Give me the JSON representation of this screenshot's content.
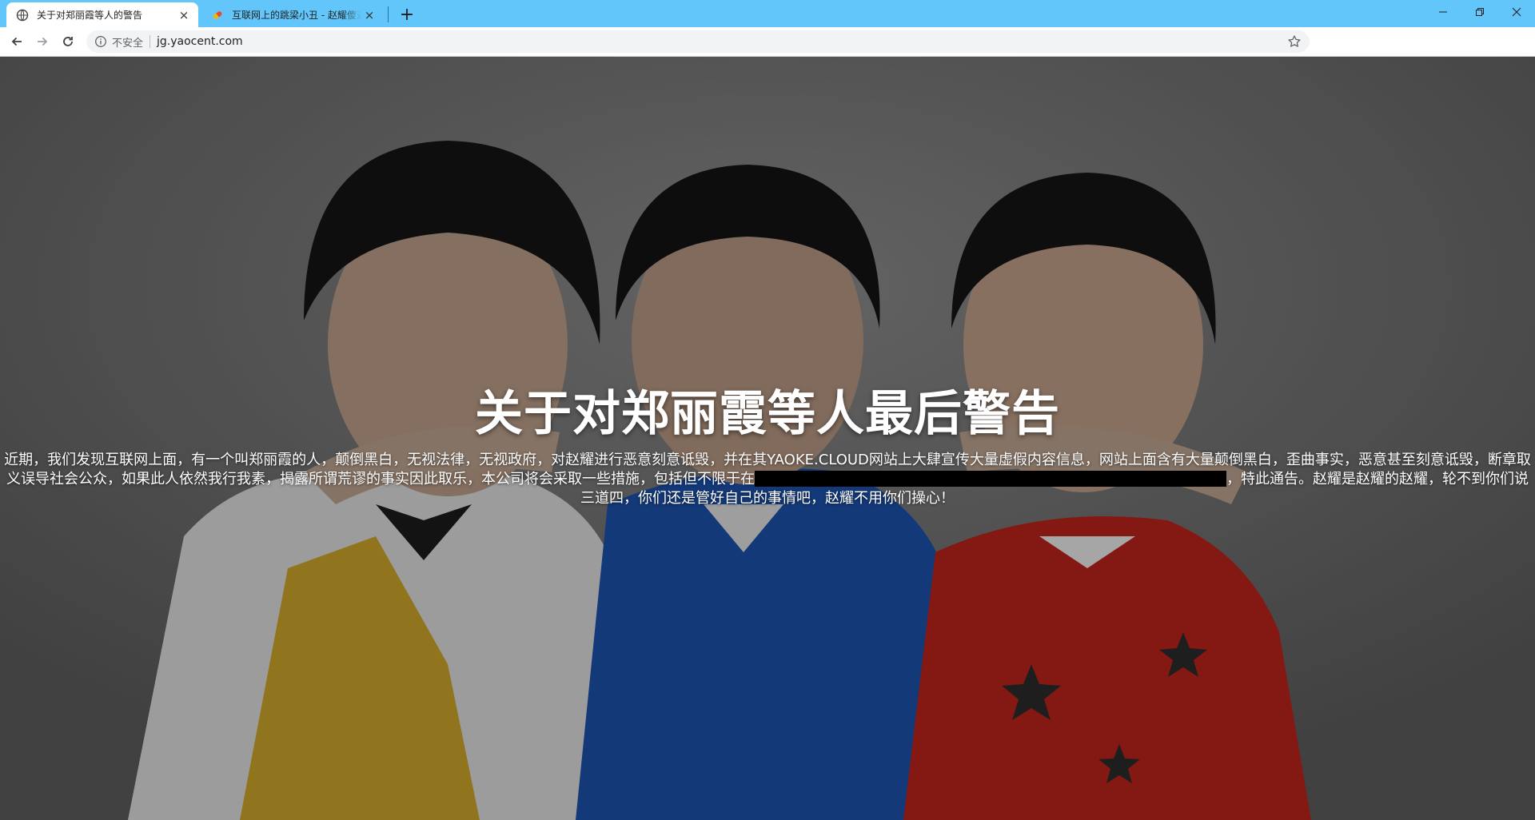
{
  "browser": {
    "tabs": [
      {
        "title": "关于对郑丽霞等人的警告",
        "active": true,
        "icon": "globe-icon"
      },
      {
        "title": "互联网上的跳梁小丑 - 赵耀傻逼",
        "active": false,
        "icon": "pill-icon"
      }
    ],
    "new_tab_label": "+",
    "close_glyph": "×",
    "address_bar": {
      "security_label": "不安全",
      "url": "jg.yaocent.com"
    },
    "colors": {
      "tabstrip": "#62c6fa",
      "toolbar": "#ffffff"
    }
  },
  "page": {
    "headline": "关于对郑丽霞等人最后警告",
    "notice_part1": "近期，我们发现互联网上面，有一个叫郑丽霞的人，颠倒黑白，无视法律，无视政府，对赵耀进行恶意刻意诋毁，并在其YAOKE.CLOUD网站上大肆宣传大量虚假内容信息，网站上面含有大量颠倒黑白，歪曲事实，恶意甚至刻意诋毁，断章取义误导社会公众，如果此人依然我行我素，揭露所谓荒谬的事实因此取乐，本公司将会采取一些措施，包括但不限于在",
    "notice_part2": "，特此通告。赵耀是赵耀的赵耀，轮不到你们说三道四，你们还是管好自己的事情吧，赵耀不用你们操心！",
    "background_image": "photo of three boys in school-style outfits, darkened overlay"
  }
}
